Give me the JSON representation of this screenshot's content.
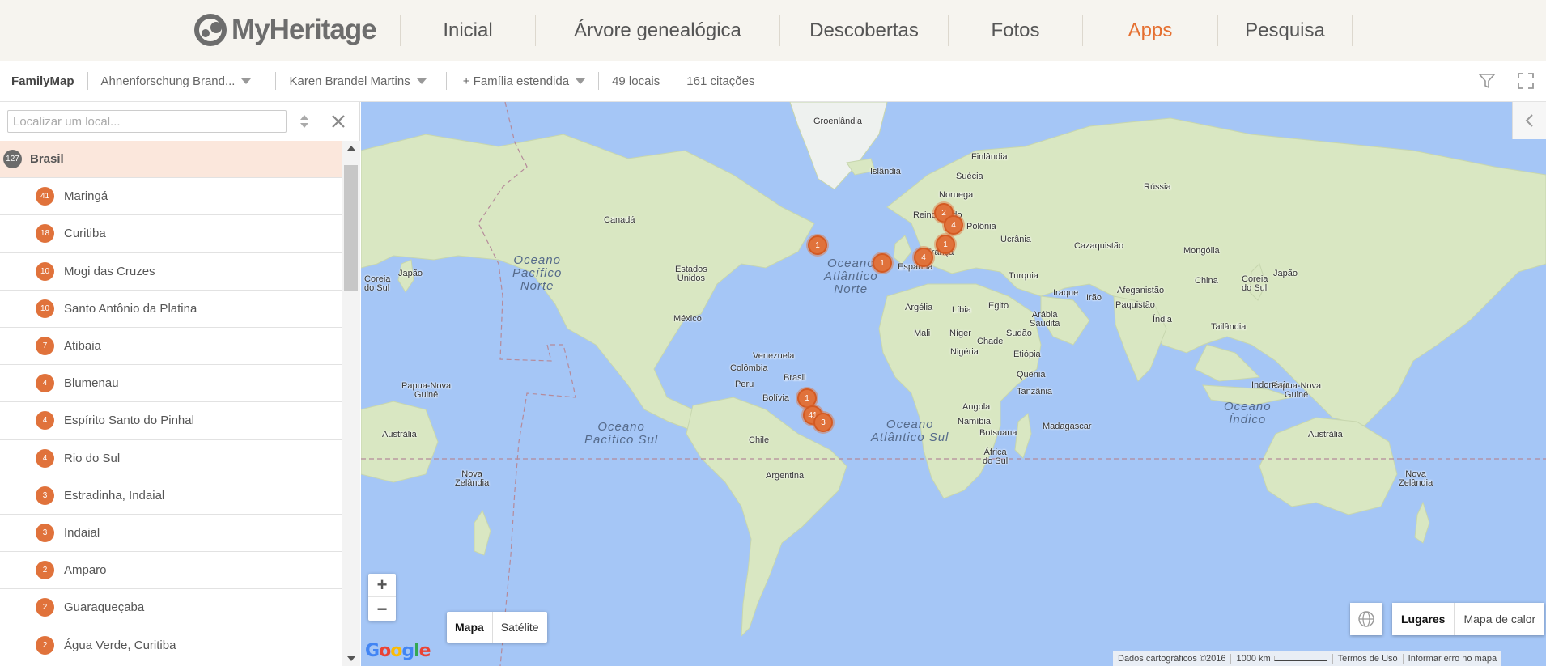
{
  "nav": {
    "logo": "MyHeritage",
    "items": [
      {
        "label": "Inicial",
        "active": false
      },
      {
        "label": "Árvore genealógica",
        "active": false
      },
      {
        "label": "Descobertas",
        "active": false
      },
      {
        "label": "Fotos",
        "active": false
      },
      {
        "label": "Apps",
        "active": true
      },
      {
        "label": "Pesquisa",
        "active": false
      }
    ]
  },
  "toolbar": {
    "brand": "FamilyMap",
    "tree_dropdown": "Ahnenforschung Brand...",
    "person_dropdown": "Karen Brandel Martins",
    "family_dropdown": "+ Família estendida",
    "locations": "49 locais",
    "citations": "161 citações",
    "icons": [
      "filter-icon",
      "fullscreen-icon"
    ]
  },
  "sidebar": {
    "search_placeholder": "Localizar um local...",
    "country": {
      "count": "127",
      "name": "Brasil"
    },
    "places": [
      {
        "count": "41",
        "name": "Maringá"
      },
      {
        "count": "18",
        "name": "Curitiba"
      },
      {
        "count": "10",
        "name": "Mogi das Cruzes"
      },
      {
        "count": "10",
        "name": "Santo Antônio da Platina"
      },
      {
        "count": "7",
        "name": "Atibaia"
      },
      {
        "count": "4",
        "name": "Blumenau"
      },
      {
        "count": "4",
        "name": "Espírito Santo do Pinhal"
      },
      {
        "count": "4",
        "name": "Rio do Sul"
      },
      {
        "count": "3",
        "name": "Estradinha, Indaial"
      },
      {
        "count": "3",
        "name": "Indaial"
      },
      {
        "count": "2",
        "name": "Amparo"
      },
      {
        "count": "2",
        "name": "Guaraqueçaba"
      },
      {
        "count": "2",
        "name": "Água Verde, Curitiba"
      }
    ]
  },
  "map": {
    "labels": {
      "groenlandia": "Groenlândia",
      "islandia": "Islândia",
      "finlandia": "Finlândia",
      "suecia": "Suécia",
      "noruega": "Noruega",
      "russia": "Rússia",
      "reino_unido": "Reino Unido",
      "polonia": "Polônia",
      "ucrania": "Ucrânia",
      "cazaquistao": "Cazaquistão",
      "mongolia": "Mongólia",
      "franca": "França",
      "espanha": "Espanha",
      "turquia": "Turquia",
      "china": "China",
      "coreia_l": "Coreia do Sul",
      "coreia_r": "Coreia do Sul",
      "japao": "Japão",
      "canada": "Canadá",
      "estados_unidos": "Estados Unidos",
      "mexico": "México",
      "iraque": "Iraque",
      "irao": "Irão",
      "afeganistao": "Afeganistão",
      "paquistao": "Paquistão",
      "argelia": "Argélia",
      "libia": "Líbia",
      "egito": "Egito",
      "arabia": "Arábia Saudita",
      "india": "Índia",
      "tailandia": "Tailândia",
      "mali": "Mali",
      "niger": "Níger",
      "chade": "Chade",
      "sudao": "Sudão",
      "nigeria": "Nigéria",
      "etiopia": "Etiópia",
      "venezuela": "Venezuela",
      "colombia": "Colômbia",
      "quenia": "Quênia",
      "indonesia": "Indonésia",
      "png_l": "Papua-Nova Guiné",
      "png_r": "Papua-Nova Guiné",
      "peru": "Peru",
      "brasil": "Brasil",
      "tanzania": "Tanzânia",
      "bolivia": "Bolívia",
      "angola": "Angola",
      "namibia": "Namíbia",
      "madagascar": "Madagascar",
      "botsuana": "Botsuana",
      "australia_l": "Austrália",
      "australia_r": "Austrália",
      "chile": "Chile",
      "africa_sul": "África do Sul",
      "nz_l": "Nova Zelândia",
      "nz_r": "Nova Zelândia",
      "argentina": "Argentina"
    },
    "oceans": {
      "pac_norte": [
        "Oceano",
        "Pacífico",
        "Norte"
      ],
      "atl_norte": [
        "Oceano",
        "Atlântico",
        "Norte"
      ],
      "pac_sul": [
        "Oceano",
        "Pacífico Sul"
      ],
      "atl_sul": [
        "Oceano",
        "Atlântico Sul"
      ],
      "indico": [
        "Oceano",
        "Índico"
      ]
    },
    "markers": [
      "1",
      "1",
      "4",
      "2",
      "4",
      "1",
      "1",
      "41",
      "3"
    ],
    "zoom_in": "+",
    "zoom_out": "−",
    "map_type": {
      "map": "Mapa",
      "satellite": "Satélite",
      "selected": "Mapa"
    },
    "view": {
      "places": "Lugares",
      "heatmap": "Mapa de calor",
      "selected": "Lugares"
    },
    "attribution": {
      "data": "Dados cartográficos ©2016",
      "scale": "1000 km",
      "terms": "Termos de Uso",
      "report": "Informar erro no mapa"
    },
    "google": "Google",
    "colors": {
      "water": "#a5c6f6",
      "land": "#d9e7c2",
      "marker": "#e0723b",
      "accent": "#e56f30"
    }
  }
}
